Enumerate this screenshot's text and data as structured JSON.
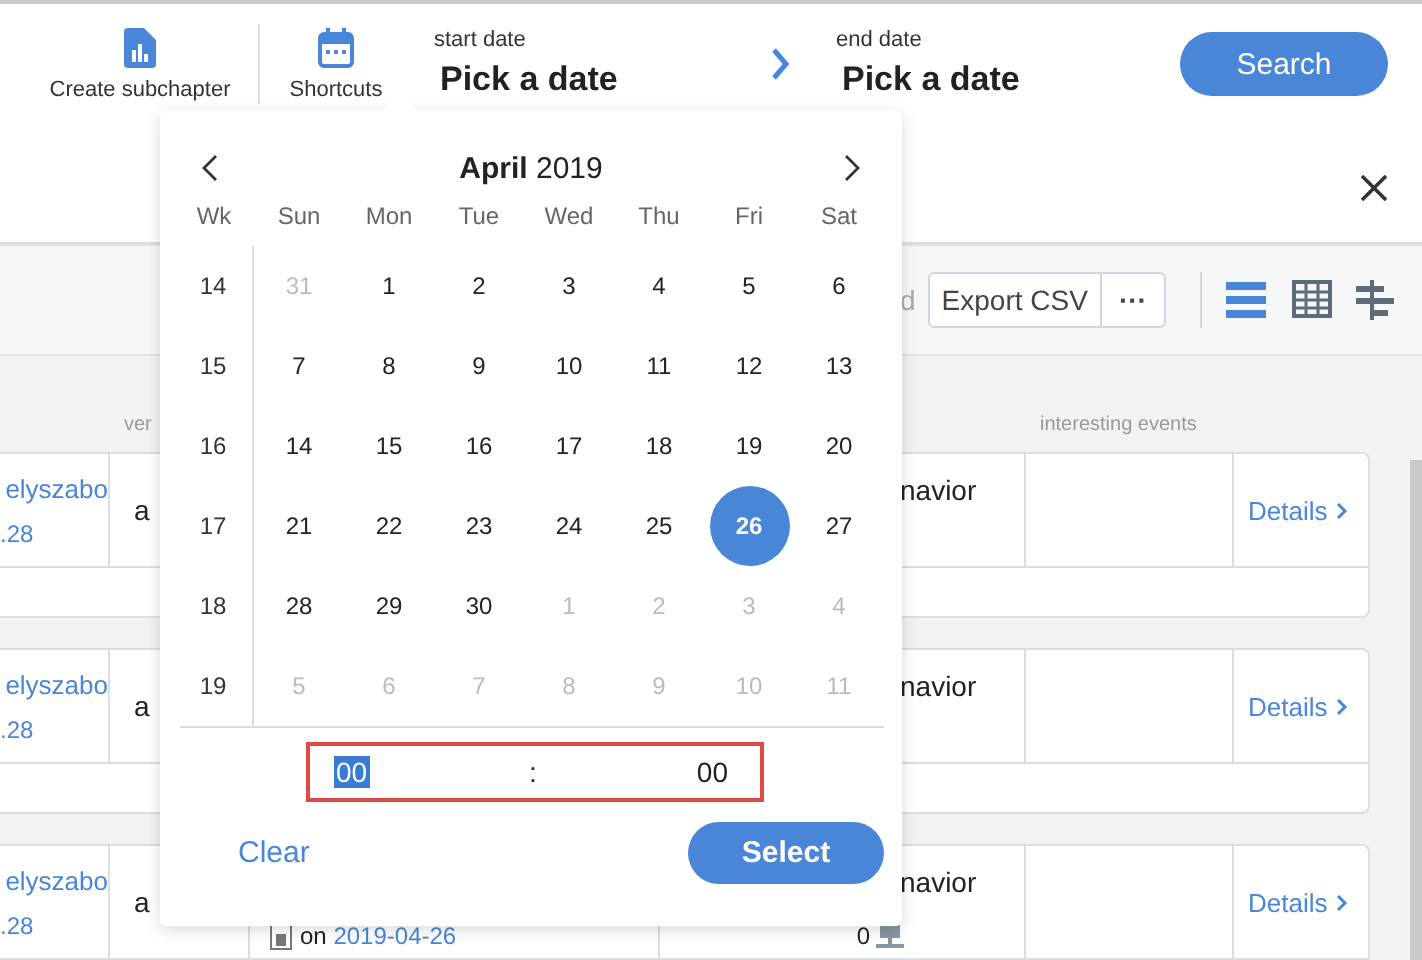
{
  "header": {
    "actions": [
      {
        "kind": "chart",
        "label": "Create subchapter"
      },
      {
        "kind": "calendar",
        "label": "Shortcuts"
      }
    ],
    "start_date": {
      "label": "start date",
      "placeholder": "Pick a date"
    },
    "end_date": {
      "label": "end date",
      "placeholder": "Pick a date"
    },
    "search_button": "Search"
  },
  "toolbar": {
    "partial_text": "d",
    "export_button": "Export CSV",
    "more_button": "···",
    "views": [
      {
        "kind": "list",
        "selected": true
      },
      {
        "kind": "grid",
        "selected": false
      },
      {
        "kind": "tree",
        "selected": false
      }
    ]
  },
  "table": {
    "columns": [
      {
        "label": "ver"
      },
      {
        "label": "interesting events"
      }
    ],
    "rows": [
      {
        "user": "elyszabo",
        "version": ".28",
        "column_2": "a",
        "column_4": "navior",
        "details": "Details"
      },
      {
        "user": "elyszabo",
        "version": ".28",
        "column_2": "a",
        "column_4": "navior",
        "details": "Details"
      },
      {
        "user": "elyszabo",
        "version": ".28",
        "column_2": "a",
        "column_4": "navior",
        "details": "Details",
        "note_prefix": "on",
        "note_date": "2019-04-26",
        "count": "0"
      }
    ]
  },
  "datepicker": {
    "month": "April",
    "year": "2019",
    "weekdays": [
      "Wk",
      "Sun",
      "Mon",
      "Tue",
      "Wed",
      "Thu",
      "Fri",
      "Sat"
    ],
    "weeks": [
      {
        "week": "14",
        "days": [
          {
            "label": "31",
            "outside": true,
            "selected": false
          },
          {
            "label": "1",
            "outside": false,
            "selected": false
          },
          {
            "label": "2",
            "outside": false,
            "selected": false
          },
          {
            "label": "3",
            "outside": false,
            "selected": false
          },
          {
            "label": "4",
            "outside": false,
            "selected": false
          },
          {
            "label": "5",
            "outside": false,
            "selected": false
          },
          {
            "label": "6",
            "outside": false,
            "selected": false
          }
        ]
      },
      {
        "week": "15",
        "days": [
          {
            "label": "7",
            "outside": false,
            "selected": false
          },
          {
            "label": "8",
            "outside": false,
            "selected": false
          },
          {
            "label": "9",
            "outside": false,
            "selected": false
          },
          {
            "label": "10",
            "outside": false,
            "selected": false
          },
          {
            "label": "11",
            "outside": false,
            "selected": false
          },
          {
            "label": "12",
            "outside": false,
            "selected": false
          },
          {
            "label": "13",
            "outside": false,
            "selected": false
          }
        ]
      },
      {
        "week": "16",
        "days": [
          {
            "label": "14",
            "outside": false,
            "selected": false
          },
          {
            "label": "15",
            "outside": false,
            "selected": false
          },
          {
            "label": "16",
            "outside": false,
            "selected": false
          },
          {
            "label": "17",
            "outside": false,
            "selected": false
          },
          {
            "label": "18",
            "outside": false,
            "selected": false
          },
          {
            "label": "19",
            "outside": false,
            "selected": false
          },
          {
            "label": "20",
            "outside": false,
            "selected": false
          }
        ]
      },
      {
        "week": "17",
        "days": [
          {
            "label": "21",
            "outside": false,
            "selected": false
          },
          {
            "label": "22",
            "outside": false,
            "selected": false
          },
          {
            "label": "23",
            "outside": false,
            "selected": false
          },
          {
            "label": "24",
            "outside": false,
            "selected": false
          },
          {
            "label": "25",
            "outside": false,
            "selected": false
          },
          {
            "label": "26",
            "outside": false,
            "selected": true
          },
          {
            "label": "27",
            "outside": false,
            "selected": false
          }
        ]
      },
      {
        "week": "18",
        "days": [
          {
            "label": "28",
            "outside": false,
            "selected": false
          },
          {
            "label": "29",
            "outside": false,
            "selected": false
          },
          {
            "label": "30",
            "outside": false,
            "selected": false
          },
          {
            "label": "1",
            "outside": true,
            "selected": false
          },
          {
            "label": "2",
            "outside": true,
            "selected": false
          },
          {
            "label": "3",
            "outside": true,
            "selected": false
          },
          {
            "label": "4",
            "outside": true,
            "selected": false
          }
        ]
      },
      {
        "week": "19",
        "days": [
          {
            "label": "5",
            "outside": true,
            "selected": false
          },
          {
            "label": "6",
            "outside": true,
            "selected": false
          },
          {
            "label": "7",
            "outside": true,
            "selected": false
          },
          {
            "label": "8",
            "outside": true,
            "selected": false
          },
          {
            "label": "9",
            "outside": true,
            "selected": false
          },
          {
            "label": "10",
            "outside": true,
            "selected": false
          },
          {
            "label": "11",
            "outside": true,
            "selected": false
          }
        ]
      }
    ],
    "time": {
      "hours": "00",
      "hours_selected": true,
      "separator": ":",
      "minutes": "00"
    },
    "clear_button": "Clear",
    "select_button": "Select"
  }
}
